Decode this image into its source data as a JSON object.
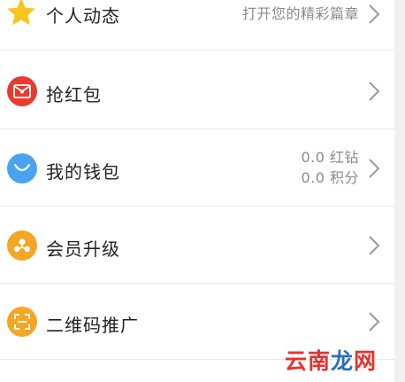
{
  "menu": {
    "items": [
      {
        "label": "个人动态",
        "value": "打开您的精彩篇章",
        "icon": "star-icon",
        "color": "#f7c51e"
      },
      {
        "label": "抢红包",
        "icon": "red-envelope-icon",
        "color": "#e83a2f"
      },
      {
        "label": "我的钱包",
        "icon": "wallet-icon",
        "color": "#4aa3f0",
        "value_lines": [
          "0.0 红钻",
          "0.0 积分"
        ]
      },
      {
        "label": "会员升级",
        "icon": "member-upgrade-icon",
        "color": "#f5a623"
      },
      {
        "label": "二维码推广",
        "icon": "qr-code-icon",
        "color": "#f5a623"
      }
    ]
  },
  "watermark": {
    "part1": "云南",
    "part2": "龙",
    "part3": "网"
  }
}
